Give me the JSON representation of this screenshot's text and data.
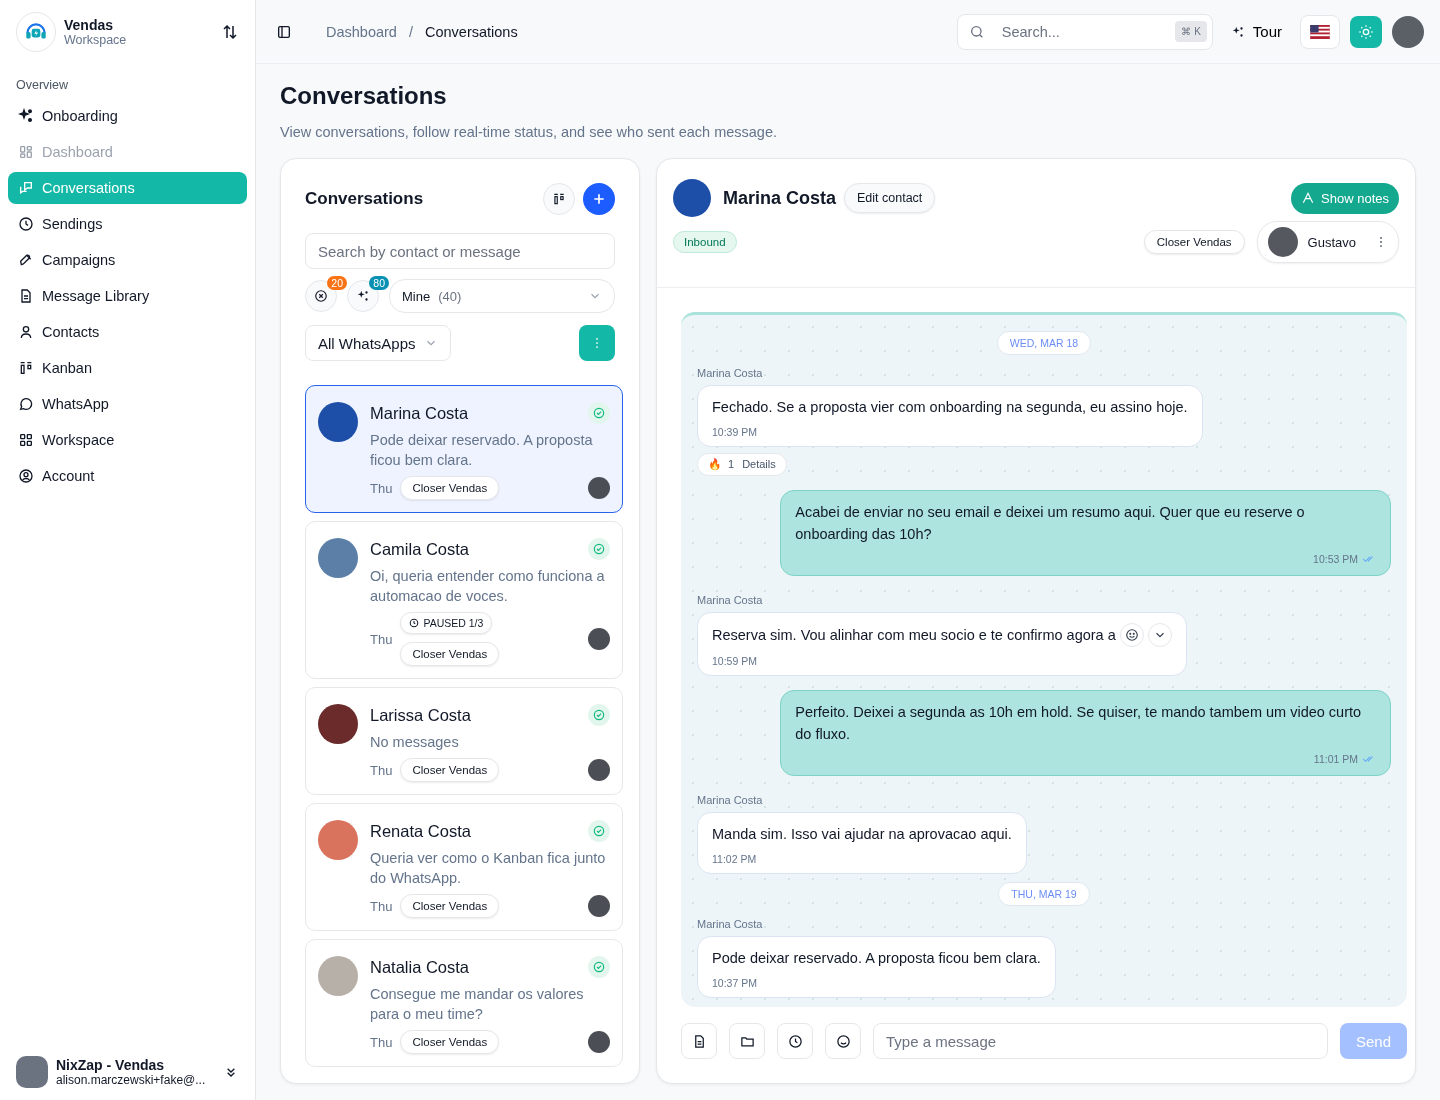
{
  "sidebar": {
    "brand": {
      "name": "Vendas",
      "subtitle": "Workspace"
    },
    "section_label": "Overview",
    "items": [
      {
        "label": "Onboarding",
        "selected": false,
        "disabled": false
      },
      {
        "label": "Dashboard",
        "selected": false,
        "disabled": true
      },
      {
        "label": "Conversations",
        "selected": true,
        "disabled": false
      },
      {
        "label": "Sendings",
        "selected": false,
        "disabled": false
      },
      {
        "label": "Campaigns",
        "selected": false,
        "disabled": false
      },
      {
        "label": "Message Library",
        "selected": false,
        "disabled": false
      },
      {
        "label": "Contacts",
        "selected": false,
        "disabled": false
      },
      {
        "label": "Kanban",
        "selected": false,
        "disabled": false
      },
      {
        "label": "WhatsApp",
        "selected": false,
        "disabled": false
      },
      {
        "label": "Workspace",
        "selected": false,
        "disabled": false
      },
      {
        "label": "Account",
        "selected": false,
        "disabled": false
      }
    ],
    "user": {
      "name": "NixZap - Vendas",
      "email": "alison.marczewski+fake@..."
    }
  },
  "topbar": {
    "breadcrumb": [
      "Dashboard",
      "Conversations"
    ],
    "breadcrumb_separator": "/",
    "search": {
      "placeholder": "Search...",
      "shortcut": "⌘ K"
    },
    "tour": "Tour"
  },
  "page": {
    "title": "Conversations",
    "subtitle": "View conversations, follow real-time status, and see who sent each message."
  },
  "list_panel": {
    "title": "Conversations",
    "search": {
      "placeholder": "Search by contact or message"
    },
    "counters": [
      "20",
      "80"
    ],
    "filter": {
      "label": "Mine",
      "count": "(40)"
    },
    "channel_filter": "All WhatsApps",
    "conversations": [
      {
        "name": "Marina Costa",
        "preview": "Pode deixar reservado. A proposta ficou bem clara.",
        "day": "Thu",
        "tag": "Closer Vendas",
        "selected": true
      },
      {
        "name": "Camila Costa",
        "preview": "Oi, queria entender como funciona a automacao de voces.",
        "day": "Thu",
        "tag": "Closer Vendas",
        "status": "PAUSED 1/3",
        "selected": false
      },
      {
        "name": "Larissa Costa",
        "preview": "No messages",
        "day": "Thu",
        "tag": "Closer Vendas",
        "selected": false
      },
      {
        "name": "Renata Costa",
        "preview": "Queria ver como o Kanban fica junto do WhatsApp.",
        "day": "Thu",
        "tag": "Closer Vendas",
        "selected": false
      },
      {
        "name": "Natalia Costa",
        "preview": "Consegue me mandar os valores para o meu time?",
        "day": "Thu",
        "tag": "Closer Vendas",
        "selected": false
      }
    ]
  },
  "chat": {
    "contact": "Marina Costa",
    "edit": "Edit contact",
    "direction": "Inbound",
    "notes_button": "Show notes",
    "team": "Closer Vendas",
    "agent": "Gustavo",
    "messages": [
      {
        "kind": "date",
        "text": "WED, MAR 18"
      },
      {
        "kind": "in",
        "sender": "Marina Costa",
        "text": "Fechado. Se a proposta vier com onboarding na segunda, eu assino hoje.",
        "time": "10:39 PM",
        "reaction": {
          "emoji": "🔥",
          "count": "1",
          "label": "Details"
        }
      },
      {
        "kind": "out",
        "text": "Acabei de enviar no seu email e deixei um resumo aqui. Quer que eu reserve o onboarding das 10h?",
        "time": "10:53 PM"
      },
      {
        "kind": "in",
        "sender": "Marina Costa",
        "text": "Reserva sim. Vou alinhar com meu socio e te confirmo agora a",
        "time": "10:59 PM",
        "hover": true
      },
      {
        "kind": "out",
        "text": "Perfeito. Deixei a segunda as 10h em hold. Se quiser, te mando tambem um video curto do fluxo.",
        "time": "11:01 PM"
      },
      {
        "kind": "in",
        "sender": "Marina Costa",
        "text": "Manda sim. Isso vai ajudar na aprovacao aqui.",
        "time": "11:02 PM"
      },
      {
        "kind": "date",
        "text": "THU, MAR 19"
      },
      {
        "kind": "in",
        "sender": "Marina Costa",
        "text": "Pode deixar reservado. A proposta ficou bem clara.",
        "time": "10:37 PM"
      }
    ],
    "composer": {
      "placeholder": "Type a message",
      "send": "Send",
      "send_disabled": true
    }
  }
}
